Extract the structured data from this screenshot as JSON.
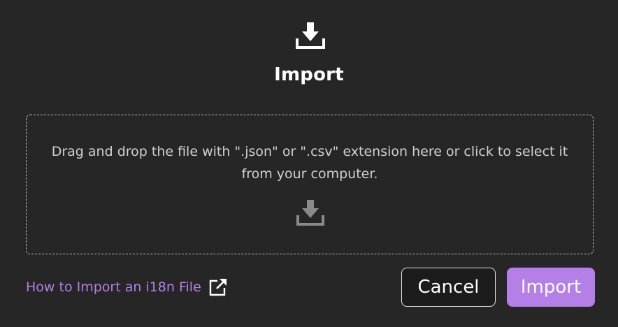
{
  "dialog": {
    "title": "Import",
    "header_icon": "download-icon",
    "dropzone": {
      "instructions": "Drag and drop the file with \".json\" or \".csv\" extension here or click to select it from your computer.",
      "icon": "download-icon"
    },
    "help_link": {
      "label": "How to Import an i18n File",
      "icon": "external-link-icon"
    },
    "buttons": {
      "cancel_label": "Cancel",
      "import_label": "Import"
    }
  },
  "colors": {
    "background": "#262626",
    "accent": "#b57fe8",
    "text": "#ffffff",
    "muted_text": "#d0d0d0",
    "dropzone_icon": "#8a8a8a"
  }
}
